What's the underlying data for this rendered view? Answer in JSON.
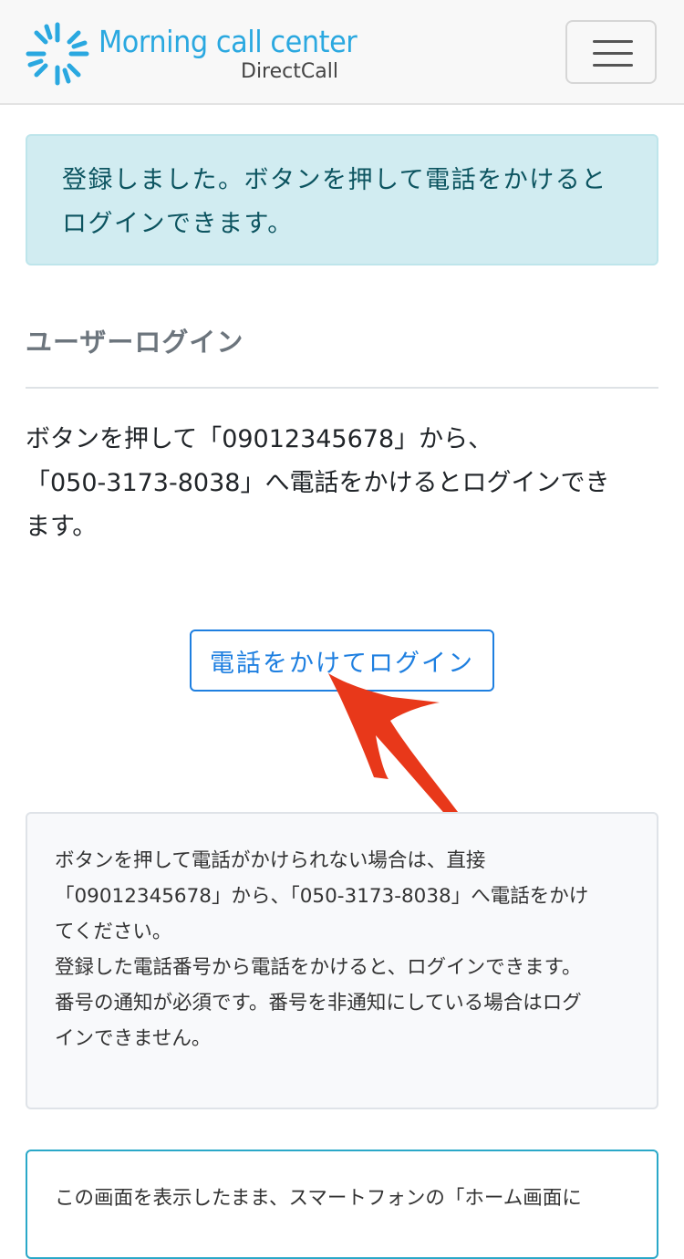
{
  "header": {
    "logo_title": "Morning call center",
    "logo_subtitle": "DirectCall",
    "logo_icon": "sunburst-logo-icon",
    "menu_icon": "hamburger-menu-icon"
  },
  "alert": {
    "line1": "登録しました。ボタンを押して電話をかけると",
    "line2": "ログインできます。"
  },
  "login": {
    "title": "ユーザーログイン",
    "intro_line1": "ボタンを押して「09012345678」から、",
    "intro_line2": "「050-3173-8038」へ電話をかけるとログインでき",
    "intro_line3": "ます。",
    "button_label": "電話をかけてログイン"
  },
  "notice": {
    "line1": "ボタンを押して電話がかけられない場合は、直接",
    "line2": "「09012345678」から、「050-3173-8038」へ電話をかけ",
    "line3": "てください。",
    "line4": "登録した電話番号から電話をかけると、ログインできます。",
    "line5": "番号の通知が必須です。番号を非通知にしている場合はログ",
    "line6": "インできません。"
  },
  "home_hint": {
    "line1": "この画面を表示したまま、スマートフォンの「ホーム画面に"
  },
  "colors": {
    "logo_blue": "#2aa8e0",
    "alert_bg": "#d1ecf1",
    "alert_text": "#0c5460",
    "button_blue": "#1e7fe0",
    "arrow_red": "#e8381a"
  }
}
